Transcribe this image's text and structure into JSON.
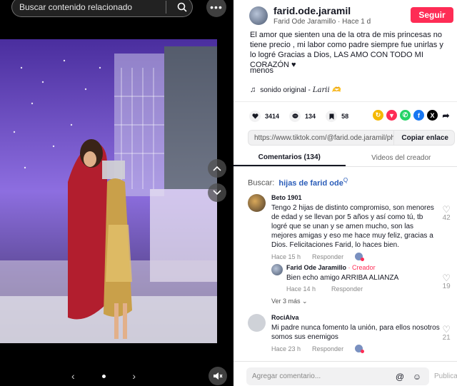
{
  "search": {
    "placeholder": "Buscar contenido relacionado"
  },
  "author": {
    "username": "farid.ode.jaramil",
    "display_name": "Farid Ode Jaramillo",
    "sep": "·",
    "time": "Hace 1 d",
    "follow_label": "Seguir"
  },
  "post": {
    "description": "El amor que sienten una de la otra de mis princesas no tiene precio , mi labor como padre siempre fue unirlas y lo logré Gracias a Dios, LAS AMO CON TODO MI CORAZÓN ♥",
    "more_label": "menos",
    "sound_label": "sonido original -",
    "sound_name": "Larii 🫶"
  },
  "stats": {
    "likes": "3414",
    "comments": "134",
    "saves": "58"
  },
  "share_icons": [
    "repost-icon",
    "repost-red-icon",
    "whatsapp-icon",
    "facebook-icon",
    "x-icon",
    "share-arrow-icon"
  ],
  "link": {
    "url": "https://www.tiktok.com/@farid.ode.jaramil/photo...",
    "copy_label": "Copiar enlace"
  },
  "tabs": [
    "Comentarios (134)",
    "Videos del creador"
  ],
  "search_comments": {
    "label": "Buscar:",
    "keyword": "hijas de farid ode",
    "suffix": "Q"
  },
  "comments": [
    {
      "name": "Beto 1901",
      "text": "Tengo 2 hijas de distinto compromiso, son menores de edad y se llevan por 5 años y así como tú, tb logré que se unan y se amen mucho, son las mejores amigas y eso me hace muy feliz, gracias a Dios. Felicitaciones Farid, lo haces bien.",
      "time": "Hace 15 h",
      "reply": "Responder",
      "likes": "42"
    },
    {
      "name": "Farid Ode Jaramillo",
      "badge": "· Creador",
      "text": "Bien echo amigo ARRIBA ALIANZA",
      "time": "Hace 14 h",
      "reply": "Responder",
      "likes": "19"
    },
    {
      "name": "RociAlva",
      "text": "Mi padre nunca fomento la unión, para ellos nosotros somos sus enemigos",
      "time": "Hace 23 h",
      "reply": "Responder",
      "likes": "21"
    }
  ],
  "see_more_label": "Ver 3 más",
  "composer": {
    "placeholder": "Agregar comentario...",
    "publish_label": "Publicar"
  },
  "colors": {
    "accent": "#fe2c55",
    "link": "#2b5db9"
  }
}
